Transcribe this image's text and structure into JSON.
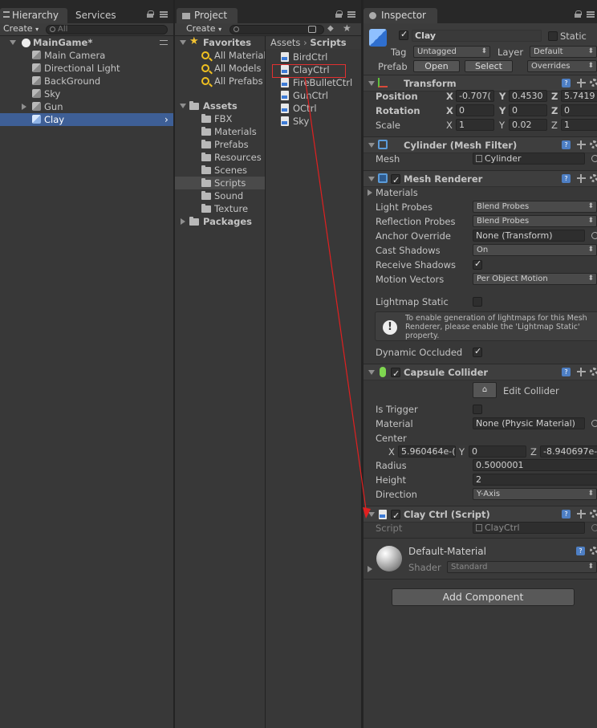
{
  "hierarchy": {
    "tabs": [
      "Hierarchy",
      "Services"
    ],
    "create_label": "Create",
    "search_placeholder": "All",
    "scene_name": "MainGame*",
    "items": [
      "Main Camera",
      "Directional Light",
      "BackGround",
      "Sky",
      "Gun",
      "Clay"
    ]
  },
  "project": {
    "tab": "Project",
    "create_label": "Create",
    "favorites_label": "Favorites",
    "favorites": [
      "All Material",
      "All Models",
      "All Prefabs"
    ],
    "assets_label": "Assets",
    "asset_folders": [
      "FBX",
      "Materials",
      "Prefabs",
      "Resources",
      "Scenes",
      "Scripts",
      "Sound",
      "Texture"
    ],
    "packages_label": "Packages",
    "breadcrumb": [
      "Assets",
      "Scripts"
    ],
    "scripts": [
      "BirdCtrl",
      "ClayCtrl",
      "FireBulletCtrl",
      "GunCtrl",
      "OCtrl",
      "Sky"
    ]
  },
  "inspector": {
    "tab": "Inspector",
    "object_name": "Clay",
    "static_label": "Static",
    "tag_label": "Tag",
    "tag_value": "Untagged",
    "layer_label": "Layer",
    "layer_value": "Default",
    "prefab_label": "Prefab",
    "open_label": "Open",
    "select_label": "Select",
    "overrides_label": "Overrides",
    "transform": {
      "title": "Transform",
      "position_label": "Position",
      "rotation_label": "Rotation",
      "scale_label": "Scale",
      "axes": [
        "X",
        "Y",
        "Z"
      ],
      "position": [
        "-0.707(",
        "0.4530",
        "5.7419"
      ],
      "rotation": [
        "0",
        "0",
        "0"
      ],
      "scale": [
        "1",
        "0.02",
        "1"
      ]
    },
    "mesh_filter": {
      "title": "Cylinder (Mesh Filter)",
      "mesh_label": "Mesh",
      "mesh_value": "Cylinder"
    },
    "mesh_renderer": {
      "title": "Mesh Renderer",
      "materials_label": "Materials",
      "light_probes_label": "Light Probes",
      "light_probes_value": "Blend Probes",
      "reflection_probes_label": "Reflection Probes",
      "reflection_probes_value": "Blend Probes",
      "anchor_label": "Anchor Override",
      "anchor_value": "None (Transform)",
      "cast_label": "Cast Shadows",
      "cast_value": "On",
      "receive_label": "Receive Shadows",
      "motion_label": "Motion Vectors",
      "motion_value": "Per Object Motion",
      "lightmap_label": "Lightmap Static",
      "info_text": "To enable generation of lightmaps for this Mesh Renderer, please enable the 'Lightmap Static' property.",
      "dynamic_label": "Dynamic Occluded"
    },
    "capsule": {
      "title": "Capsule Collider",
      "edit_label": "Edit Collider",
      "trigger_label": "Is Trigger",
      "material_label": "Material",
      "material_value": "None (Physic Material)",
      "center_label": "Center",
      "center_axes": [
        "X",
        "Y",
        "Z"
      ],
      "center": [
        "5.960464e-(",
        "0",
        "-8.940697e-"
      ],
      "radius_label": "Radius",
      "radius_value": "0.5000001",
      "height_label": "Height",
      "height_value": "2",
      "direction_label": "Direction",
      "direction_value": "Y-Axis"
    },
    "script_comp": {
      "title": "Clay Ctrl (Script)",
      "script_label": "Script",
      "script_value": "ClayCtrl"
    },
    "material": {
      "name": "Default-Material",
      "shader_label": "Shader",
      "shader_value": "Standard"
    },
    "add_component_label": "Add Component"
  }
}
